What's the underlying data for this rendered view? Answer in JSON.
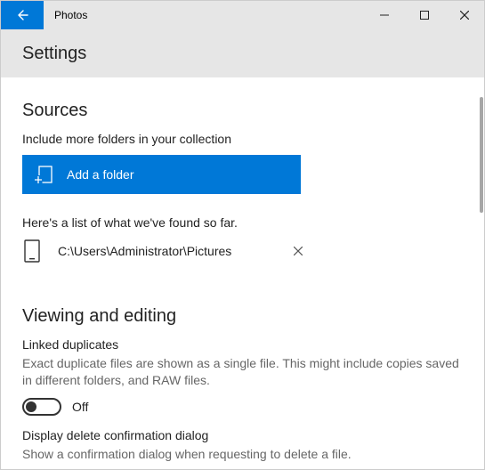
{
  "titlebar": {
    "app_title": "Photos"
  },
  "header": {
    "title": "Settings"
  },
  "sources": {
    "heading": "Sources",
    "include_label": "Include more folders in your collection",
    "add_button": "Add a folder",
    "found_label": "Here's a list of what we've found so far.",
    "folders": [
      {
        "path": "C:\\Users\\Administrator\\Pictures"
      }
    ]
  },
  "viewing": {
    "heading": "Viewing and editing",
    "linked_dup_label": "Linked duplicates",
    "linked_dup_desc": "Exact duplicate files are shown as a single file. This might include copies saved in different folders, and RAW files.",
    "linked_dup_toggle": "Off",
    "delete_confirm_label": "Display delete confirmation dialog",
    "delete_confirm_desc": "Show a confirmation dialog when requesting to delete a file."
  },
  "colors": {
    "accent": "#0078D7"
  }
}
